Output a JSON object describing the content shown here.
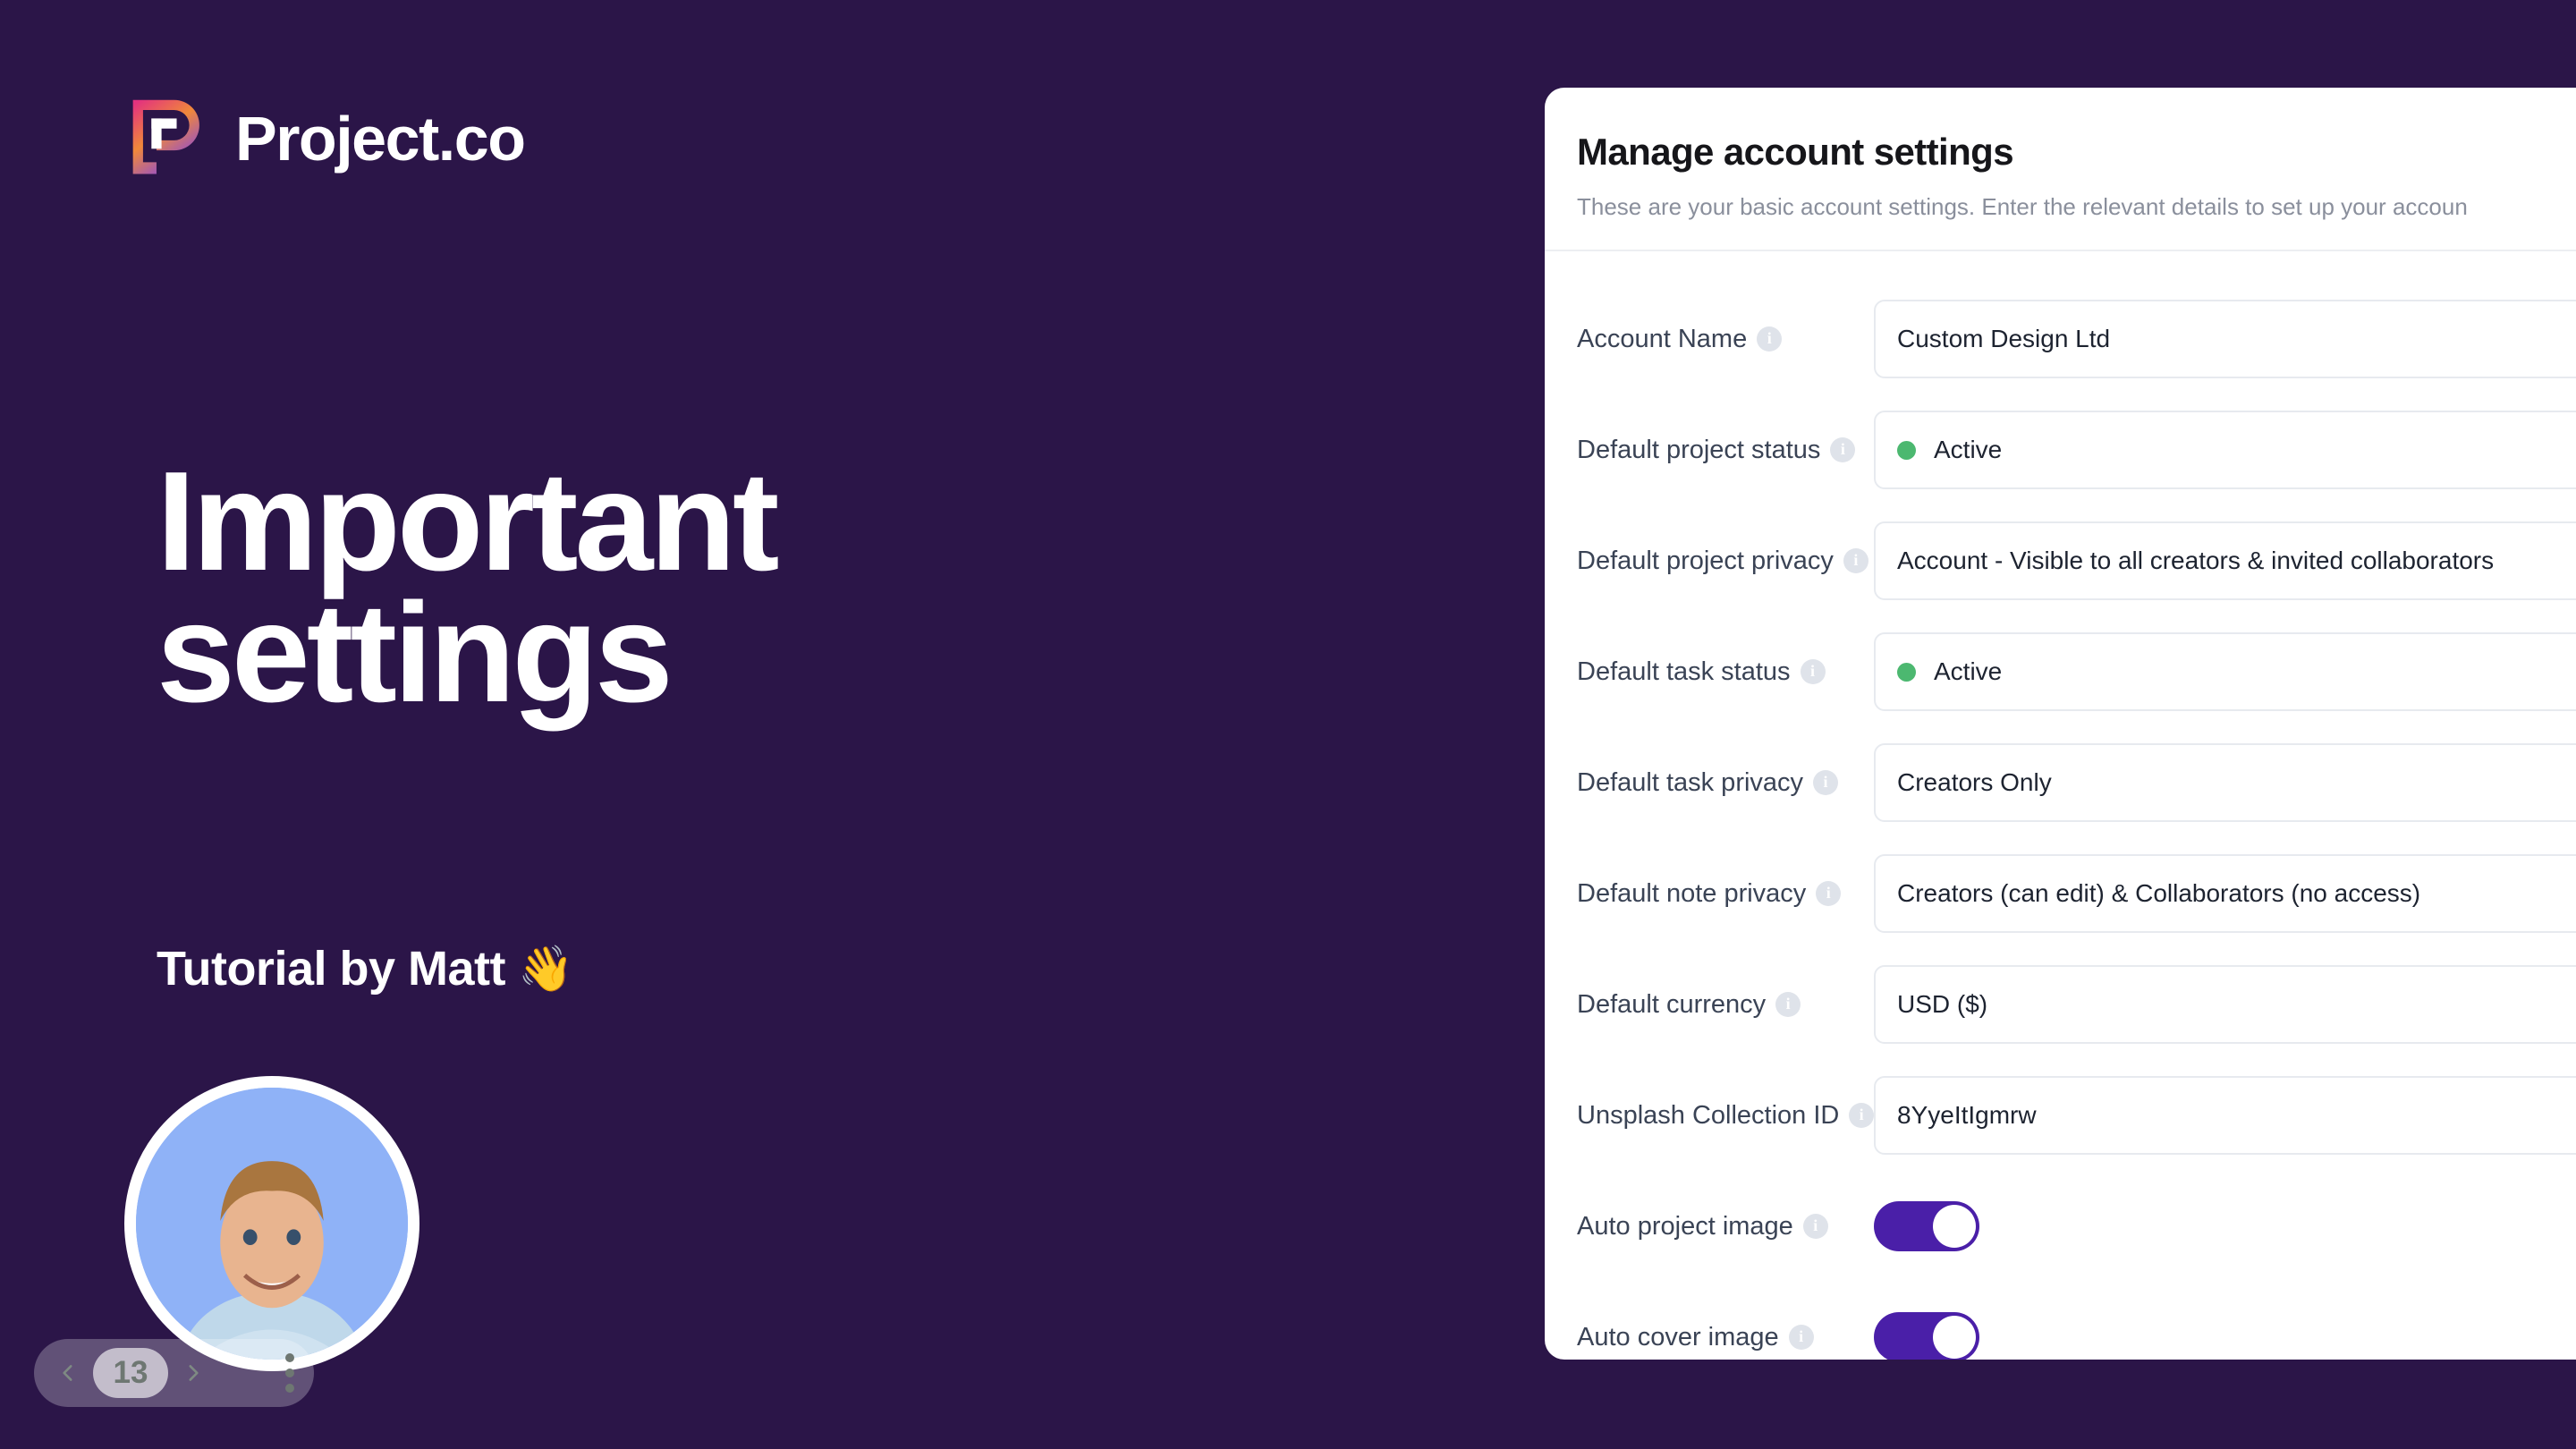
{
  "brand": {
    "name": "Project.co",
    "logo_icon": "project-co-logo-icon",
    "gradient_from": "#e3327e",
    "gradient_mid": "#f0883a",
    "gradient_to": "#7b3ff2"
  },
  "background_color": "#2b1548",
  "hero": {
    "headline_line1": "Important",
    "headline_line2": "settings",
    "byline": "Tutorial by Matt",
    "byline_emoji": "👋"
  },
  "pager": {
    "prev_icon": "chevron-left-icon",
    "next_icon": "chevron-right-icon",
    "page_number": "13",
    "menu_icon": "more-vertical-icon"
  },
  "panel": {
    "title": "Manage account settings",
    "description": "These are your basic account settings. Enter the relevant details to set up your accoun",
    "accent_color": "#4a1fa8",
    "status_dot_color": "#4cb870",
    "rows": [
      {
        "label": "Account Name",
        "info_icon": "info-icon",
        "type": "text",
        "value": "Custom Design Ltd"
      },
      {
        "label": "Default project status",
        "info_icon": "info-icon",
        "type": "status",
        "value": "Active"
      },
      {
        "label": "Default project privacy",
        "info_icon": "info-icon",
        "type": "text",
        "value": "Account - Visible to all creators & invited collaborators"
      },
      {
        "label": "Default task status",
        "info_icon": "info-icon",
        "type": "status",
        "value": "Active"
      },
      {
        "label": "Default task privacy",
        "info_icon": "info-icon",
        "type": "text",
        "value": "Creators Only"
      },
      {
        "label": "Default note privacy",
        "info_icon": "info-icon",
        "type": "text",
        "value": "Creators (can edit) & Collaborators (no access)"
      },
      {
        "label": "Default currency",
        "info_icon": "info-icon",
        "type": "text",
        "value": "USD ($)"
      },
      {
        "label": "Unsplash Collection ID",
        "info_icon": "info-icon",
        "type": "text",
        "value": "8YyeItIgmrw"
      },
      {
        "label": "Auto project image",
        "info_icon": "info-icon",
        "type": "toggle",
        "value": "on"
      },
      {
        "label": "Auto cover image",
        "info_icon": "info-icon",
        "type": "toggle",
        "value": "on"
      }
    ]
  }
}
